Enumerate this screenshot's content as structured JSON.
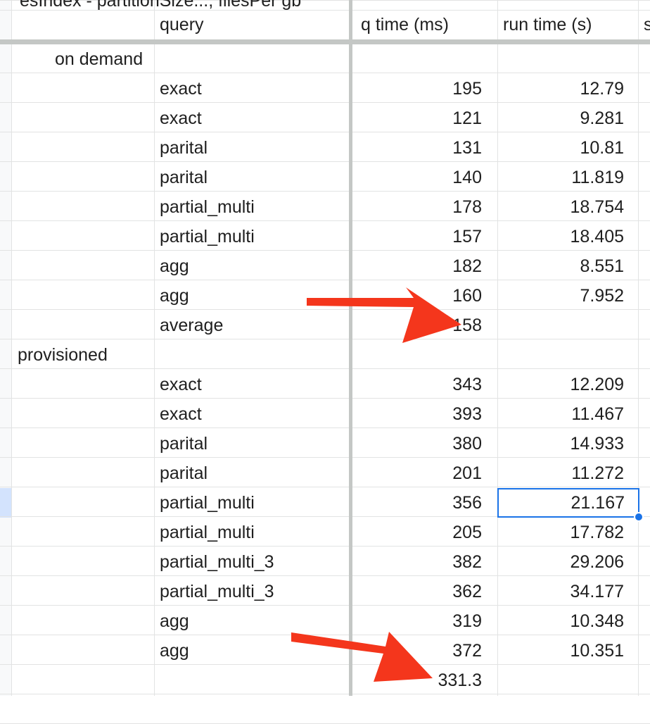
{
  "sheet": {
    "top_cut_text": "esIndex - partitionSize..., filesPer gb",
    "headers": {
      "query": "query",
      "q_time": "q time (ms)",
      "run_time": "run time (s)",
      "next_col_fragment": "s"
    },
    "sections": [
      {
        "label": "on demand",
        "rows": [
          {
            "query": "exact",
            "q_time": "195",
            "run_time": "12.79"
          },
          {
            "query": "exact",
            "q_time": "121",
            "run_time": "9.281"
          },
          {
            "query": "parital",
            "q_time": "131",
            "run_time": "10.81"
          },
          {
            "query": "parital",
            "q_time": "140",
            "run_time": "11.819"
          },
          {
            "query": "partial_multi",
            "q_time": "178",
            "run_time": "18.754"
          },
          {
            "query": "partial_multi",
            "q_time": "157",
            "run_time": "18.405"
          },
          {
            "query": "agg",
            "q_time": "182",
            "run_time": "8.551"
          },
          {
            "query": "agg",
            "q_time": "160",
            "run_time": "7.952"
          },
          {
            "query": "average",
            "q_time": "158",
            "run_time": ""
          }
        ]
      },
      {
        "label": "provisioned",
        "rows": [
          {
            "query": "exact",
            "q_time": "343",
            "run_time": "12.209"
          },
          {
            "query": "exact",
            "q_time": "393",
            "run_time": "11.467"
          },
          {
            "query": "parital",
            "q_time": "380",
            "run_time": "14.933"
          },
          {
            "query": "parital",
            "q_time": "201",
            "run_time": "11.272"
          },
          {
            "query": "partial_multi",
            "q_time": "356",
            "run_time": "21.167"
          },
          {
            "query": "partial_multi",
            "q_time": "205",
            "run_time": "17.782"
          },
          {
            "query": "partial_multi_3",
            "q_time": "382",
            "run_time": "29.206"
          },
          {
            "query": "partial_multi_3",
            "q_time": "362",
            "run_time": "34.177"
          },
          {
            "query": "agg",
            "q_time": "319",
            "run_time": "10.348"
          },
          {
            "query": "agg",
            "q_time": "372",
            "run_time": "10.351"
          },
          {
            "query": "",
            "q_time": "331.3",
            "run_time": ""
          }
        ]
      }
    ],
    "selected_cell": "21.167",
    "colors": {
      "grid": "#e2e3e3",
      "freeze_bar": "#c4c7c5",
      "selection": "#1a73e8",
      "arrow": "#f4361c"
    }
  }
}
